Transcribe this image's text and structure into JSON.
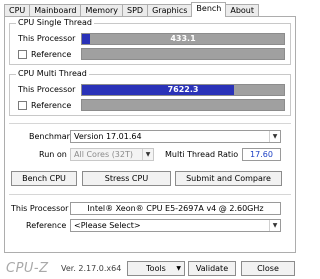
{
  "tabs": [
    "CPU",
    "Mainboard",
    "Memory",
    "SPD",
    "Graphics",
    "Bench",
    "About"
  ],
  "single": {
    "title": "CPU Single Thread",
    "this_label": "This Processor",
    "ref_label": "Reference",
    "value": "433.1",
    "fill_fraction": 0.04,
    "fill_color": "#2a32b8"
  },
  "multi": {
    "title": "CPU Multi Thread",
    "this_label": "This Processor",
    "ref_label": "Reference",
    "value": "7622.3",
    "fill_fraction": 0.75,
    "fill_color": "#2a32b8"
  },
  "settings": {
    "benchmark_label": "Benchmark",
    "benchmark_value": "Version 17.01.64",
    "runon_label": "Run on",
    "runon_value": "All Cores (32T)",
    "ratio_label": "Multi Thread Ratio",
    "ratio_value": "17.60"
  },
  "buttons": {
    "bench_cpu": "Bench CPU",
    "stress_cpu": "Stress CPU",
    "submit": "Submit and Compare"
  },
  "processor": {
    "this_label": "This Processor",
    "this_value": "Intel® Xeon® CPU E5-2697A v4 @ 2.60GHz",
    "ref_label": "Reference",
    "ref_value": "<Please Select>"
  },
  "footer": {
    "logo": "CPU-Z",
    "version": "Ver. 2.17.0.x64",
    "tools": "Tools",
    "validate": "Validate",
    "close": "Close"
  },
  "icons": {
    "dropdown": "chevron-down-icon"
  }
}
